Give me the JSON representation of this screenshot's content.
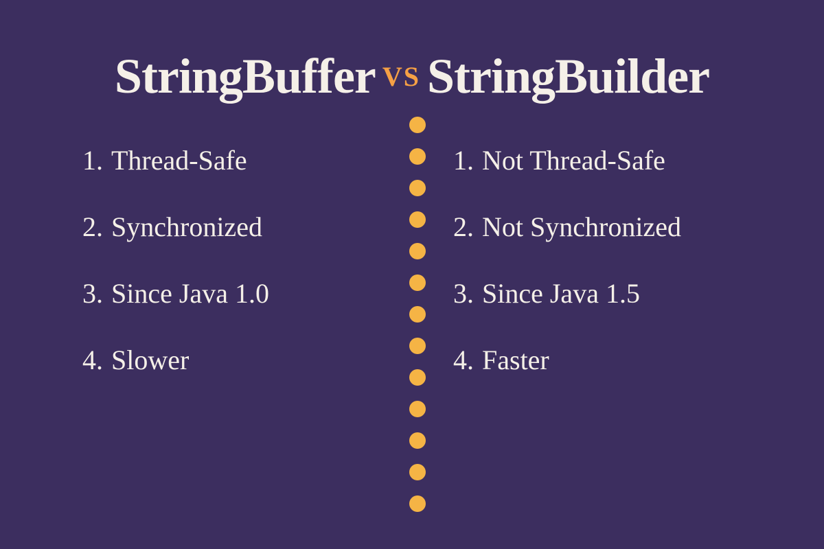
{
  "left": {
    "title": "StringBuffer",
    "items": [
      {
        "num": "1.",
        "text": "Thread-Safe"
      },
      {
        "num": "2.",
        "text": "Synchronized"
      },
      {
        "num": "3.",
        "text": "Since Java 1.0"
      },
      {
        "num": "4.",
        "text": "Slower"
      }
    ]
  },
  "vs": "VS",
  "right": {
    "title": "StringBuilder",
    "items": [
      {
        "num": "1.",
        "text": "Not Thread-Safe"
      },
      {
        "num": "2.",
        "text": "Not Synchronized"
      },
      {
        "num": "3.",
        "text": "Since Java 1.5"
      },
      {
        "num": "4.",
        "text": "Faster"
      }
    ]
  },
  "dot_count": 13
}
